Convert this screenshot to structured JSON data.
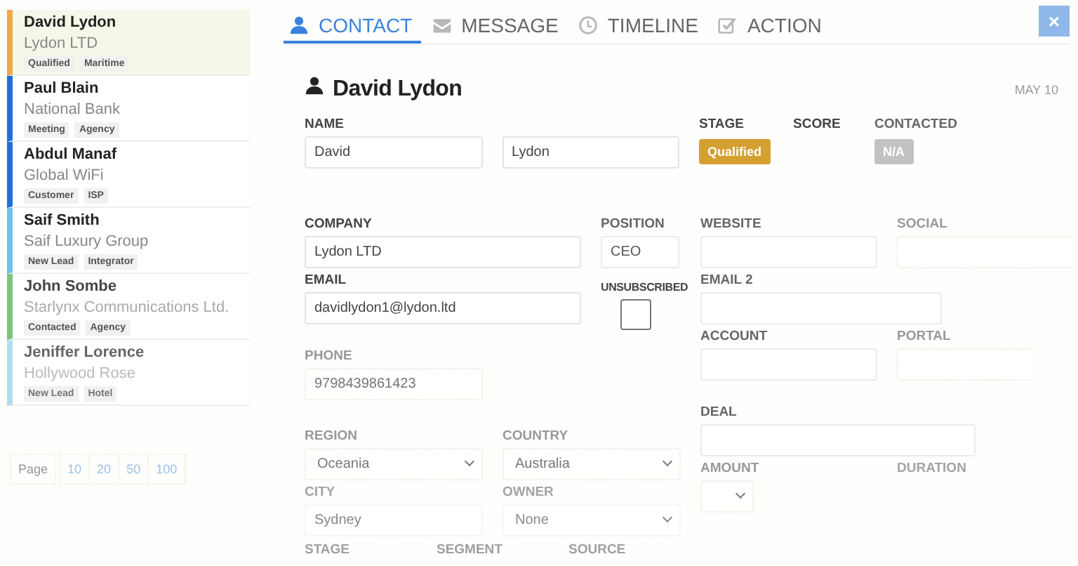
{
  "contacts": [
    {
      "name": "David Lydon",
      "company": "Lydon LTD",
      "tags": [
        "Qualified",
        "Maritime"
      ],
      "color": "#f0a840",
      "selected": true
    },
    {
      "name": "Paul Blain",
      "company": "National Bank",
      "tags": [
        "Meeting",
        "Agency"
      ],
      "color": "#1e6fd9",
      "selected": false
    },
    {
      "name": "Abdul Manaf",
      "company": "Global WiFi",
      "tags": [
        "Customer",
        "ISP"
      ],
      "color": "#1e6fd9",
      "selected": false
    },
    {
      "name": "Saif Smith",
      "company": "Saif Luxury Group",
      "tags": [
        "New Lead",
        "Integrator"
      ],
      "color": "#6cc3e8",
      "selected": false
    },
    {
      "name": "John Sombe",
      "company": "Starlynx Communications Ltd.",
      "tags": [
        "Contacted",
        "Agency"
      ],
      "color": "#7cc47a",
      "selected": false
    },
    {
      "name": "Jeniffer Lorence",
      "company": "Hollywood Rose",
      "tags": [
        "New Lead",
        "Hotel"
      ],
      "color": "#b4dcf0",
      "selected": false
    }
  ],
  "pagination": {
    "label": "Page",
    "sizes": [
      "10",
      "20",
      "50",
      "100"
    ]
  },
  "tabs": [
    {
      "label": "CONTACT",
      "selected": true
    },
    {
      "label": "MESSAGE",
      "selected": false
    },
    {
      "label": "TIMELINE",
      "selected": false
    },
    {
      "label": "ACTION",
      "selected": false
    }
  ],
  "close_button": {
    "label": "×"
  },
  "contact": {
    "title": "David Lydon",
    "date": "MAY 10",
    "name": {
      "label": "NAME",
      "first": "David",
      "last": "Lydon"
    },
    "stage": {
      "label": "STAGE",
      "value": "Qualified"
    },
    "score": {
      "label": "SCORE"
    },
    "contacted": {
      "label": "CONTACTED",
      "value": "N/A"
    },
    "company": {
      "label": "COMPANY",
      "value": "Lydon LTD"
    },
    "position": {
      "label": "POSITION",
      "value": "CEO"
    },
    "email": {
      "label": "EMAIL",
      "value": "davidlydon1@lydon.ltd"
    },
    "unsubscribed": {
      "label": "UNSUBSCRIBED",
      "checked": false
    },
    "phone": {
      "label": "PHONE",
      "value": "9798439861423"
    },
    "region": {
      "label": "REGION",
      "value": "Oceania"
    },
    "country": {
      "label": "COUNTRY",
      "value": "Australia"
    },
    "city": {
      "label": "CITY",
      "value": "Sydney"
    },
    "owner": {
      "label": "OWNER",
      "value": "None"
    },
    "bottom_labels": [
      "STAGE",
      "SEGMENT",
      "SOURCE"
    ],
    "website": {
      "label": "WEBSITE"
    },
    "social": {
      "label": "SOCIAL"
    },
    "email_2": {
      "label": "EMAIL 2"
    },
    "account": {
      "label": "ACCOUNT"
    },
    "portal": {
      "label": "PORTAL"
    },
    "deal": {
      "label": "DEAL"
    },
    "amount": {
      "label": "AMOUNT"
    },
    "duration": {
      "label": "DURATION"
    }
  }
}
